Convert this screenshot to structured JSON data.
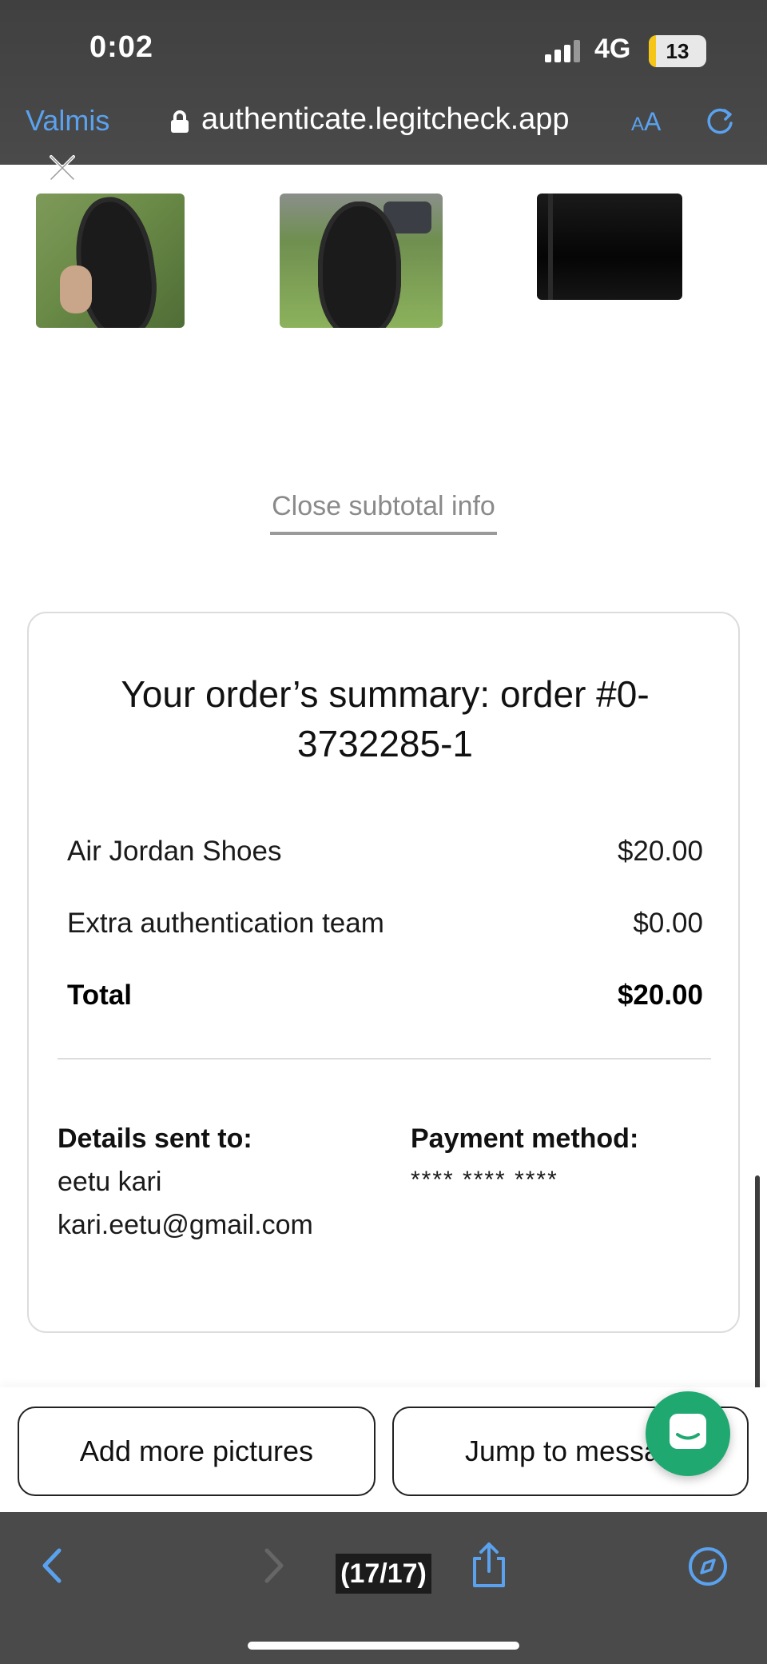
{
  "status_bar": {
    "time": "0:02",
    "network": "4G",
    "battery_level": "13",
    "battery_percent": 13,
    "battery_color": "#f5c518"
  },
  "browser": {
    "back_app": "Valmis",
    "url": "authenticate.legitcheck.app",
    "text_size_small": "A",
    "text_size_large": "A"
  },
  "gallery": {
    "close_icon": "close-icon",
    "thumbnails": [
      "shoe-sole-photo",
      "shoe-sole-photo-outdoor",
      "dark-photo"
    ]
  },
  "subtotal_toggle": "Close subtotal info",
  "order_summary": {
    "title": "Your order’s summary: order #0-3732285-1",
    "items": [
      {
        "label": "Air Jordan Shoes",
        "amount": "$20.00"
      },
      {
        "label": "Extra authentication team",
        "amount": "$0.00"
      }
    ],
    "total": {
      "label": "Total",
      "amount": "$20.00"
    },
    "details_heading": "Details sent to:",
    "name": "eetu kari",
    "email": "kari.eetu@gmail.com",
    "payment_heading": "Payment method:",
    "payment_value": "**** **** ****"
  },
  "actions": {
    "add_pictures": "Add more pictures",
    "jump_messages": "Jump to messag"
  },
  "chat_button": {
    "icon": "chat-icon",
    "color": "#1fa971"
  },
  "toolbar": {
    "page_counter": "(17/17)",
    "back": "chevron-left-icon",
    "forward": "chevron-right-icon",
    "share": "share-icon",
    "safari": "compass-icon"
  },
  "colors": {
    "accent": "#5aa2ef",
    "chrome": "#4a4a4a"
  }
}
